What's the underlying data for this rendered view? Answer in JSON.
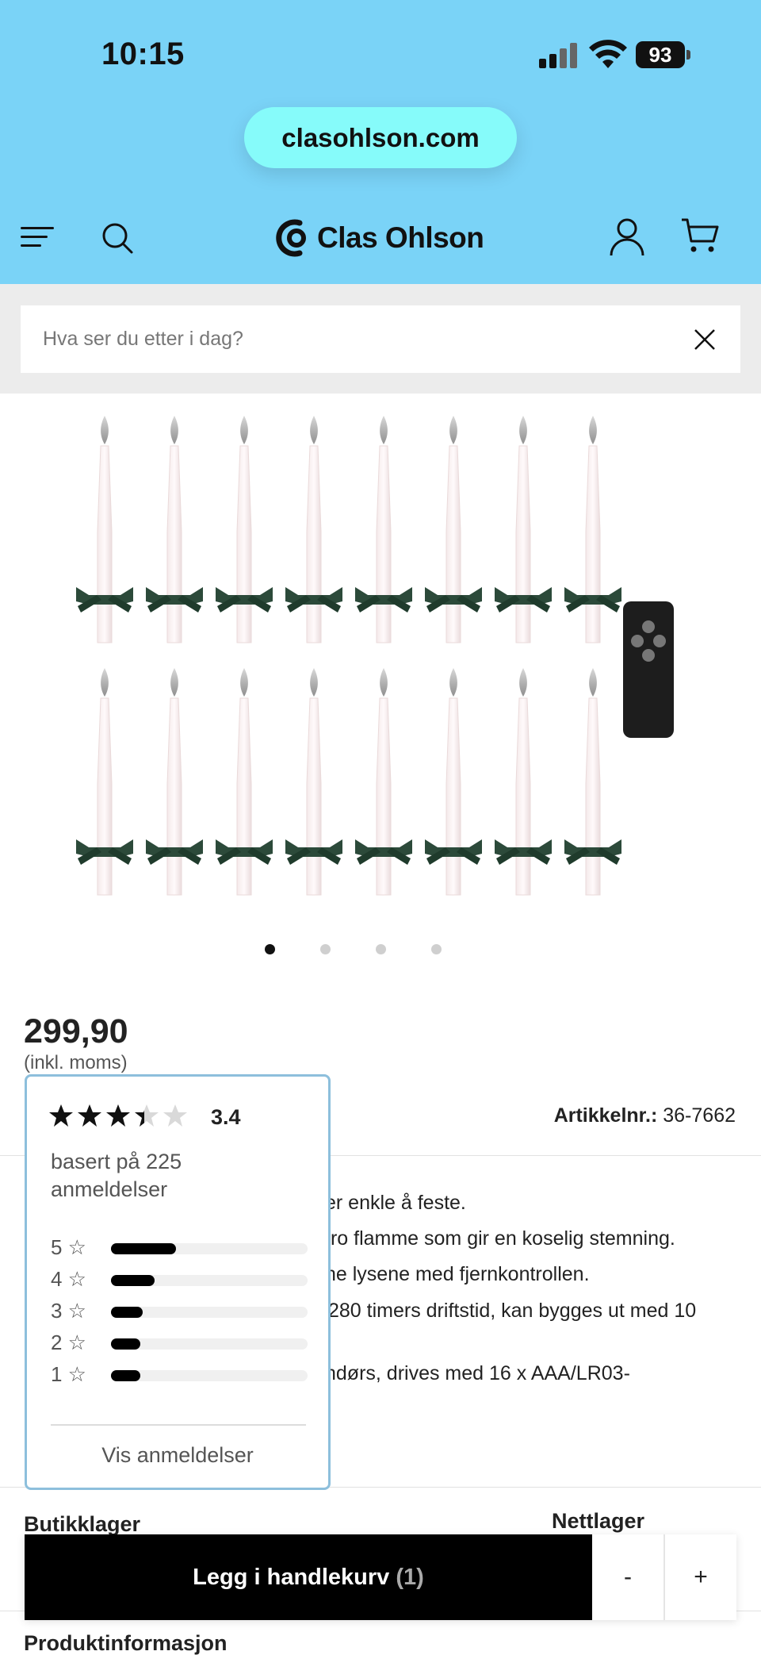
{
  "status_bar": {
    "time": "10:15",
    "battery": "93",
    "icons": [
      "signal-icon",
      "wifi-icon",
      "battery-icon"
    ]
  },
  "browser": {
    "url": "clasohlson.com"
  },
  "header": {
    "brand": "Clas Ohlson",
    "icons": [
      "menu-icon",
      "search-icon",
      "clas-ohlson-logo-icon",
      "user-icon",
      "cart-icon"
    ]
  },
  "search": {
    "placeholder": "Hva ser du etter i dag?"
  },
  "gallery": {
    "total_images": 4,
    "active_index": 0
  },
  "product": {
    "price": "299,90",
    "vat_note": "(inkl. moms)",
    "article_label": "Artikkelnr.:",
    "article_number": "36-7662",
    "bullets": [
      "er enkle å feste.",
      "tro flamme som gir en koselig stemning.",
      "ne lysene med fjernkontrollen.",
      "280 timers driftstid, kan bygges ut med 10",
      "ndørs, drives med 16 x AAA/LR03-"
    ]
  },
  "rating": {
    "score": "3.4",
    "stars_value": 3.4,
    "based_on": "basert på 225 anmeldelser",
    "histogram": [
      {
        "label": "5 ☆",
        "fraction": 0.33
      },
      {
        "label": "4 ☆",
        "fraction": 0.22
      },
      {
        "label": "3 ☆",
        "fraction": 0.16
      },
      {
        "label": "2 ☆",
        "fraction": 0.15
      },
      {
        "label": "1 ☆",
        "fraction": 0.15
      }
    ],
    "show_reviews": "Vis anmeldelser",
    "accent_color": "#8dbfdc"
  },
  "stock": {
    "store": "Butikklager",
    "online": "Nettlager"
  },
  "cart_bar": {
    "add_label": "Legg i handlekurv",
    "quantity": "(1)",
    "minus": "-",
    "plus": "+"
  },
  "section": {
    "product_info": "Produktinformasjon"
  },
  "colors": {
    "header_bg": "#7ad3f7",
    "url_pill": "#86fbfa",
    "button_bg": "#000000"
  }
}
